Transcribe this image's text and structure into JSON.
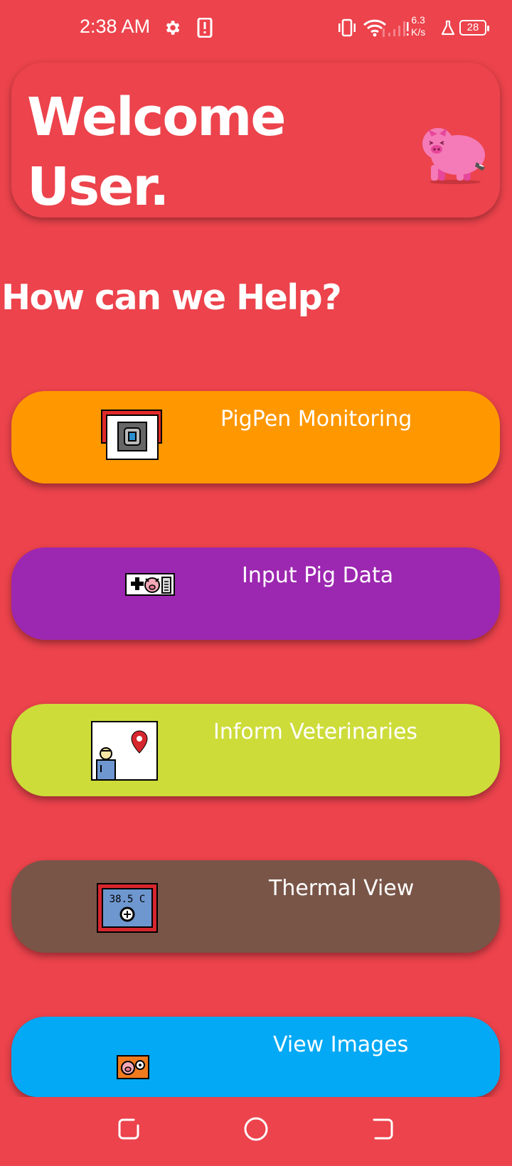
{
  "status_bar": {
    "time": "2:38 AM",
    "net_speed_value": "6.3",
    "net_speed_unit": "K/s",
    "battery": "28",
    "icons": [
      "gear-icon",
      "phone-alert-icon",
      "vibrate-icon",
      "wifi-icon",
      "signal-icon",
      "flask-icon",
      "battery-icon"
    ]
  },
  "header": {
    "welcome_line1": "Welcome",
    "welcome_line2": "User.",
    "mascot": "pig-mascot"
  },
  "help_heading": "How can we Help?",
  "menu": [
    {
      "label": "PigPen Monitoring",
      "color": "#FF9800",
      "icon": "camera-monitor-icon"
    },
    {
      "label": "Input Pig Data",
      "color": "#9C27B0",
      "icon": "pig-data-icon"
    },
    {
      "label": "Inform Veterinaries",
      "color": "#CDDC39",
      "icon": "vet-location-icon"
    },
    {
      "label": "Thermal View",
      "color": "#795548",
      "icon": "thermometer-display-icon"
    },
    {
      "label": "View Images",
      "color": "#03A9F4",
      "icon": "pig-image-icon"
    }
  ],
  "thermal_icon_text": "38.5 C",
  "nav_bar": {
    "buttons": [
      "recent-apps-icon",
      "home-icon",
      "back-icon"
    ]
  }
}
